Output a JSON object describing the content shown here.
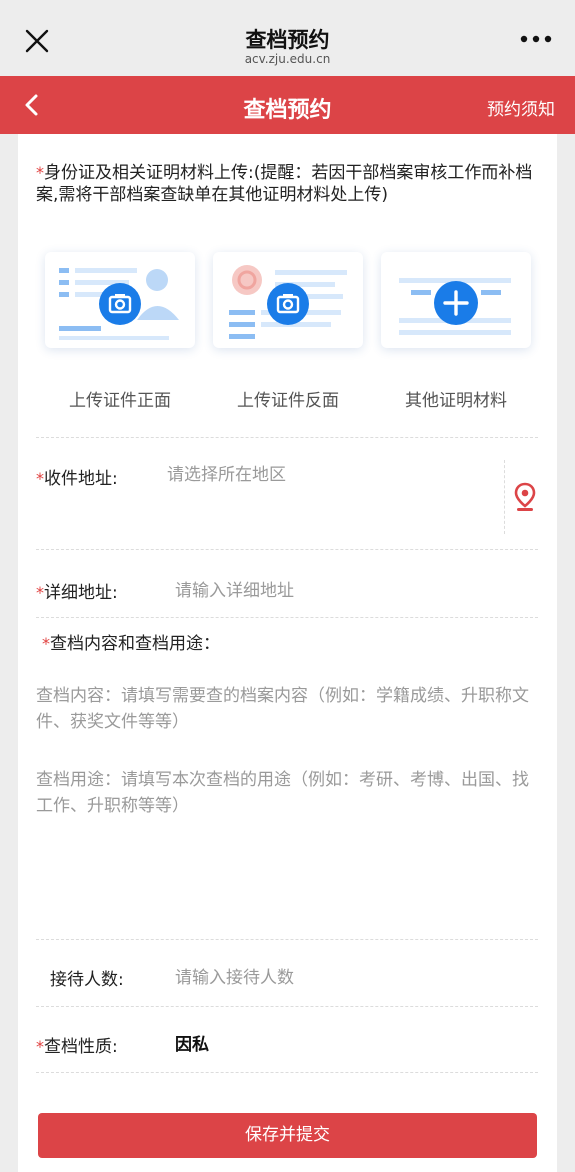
{
  "wechat": {
    "title": "查档预约",
    "domain": "acv.zju.edu.cn"
  },
  "header": {
    "title": "查档预约",
    "notice_link": "预约须知"
  },
  "upload": {
    "required_mark": "*",
    "note": "身份证及相关证明材料上传:(提醒：若因干部档案审核工作而补档案,需将干部档案查缺单在其他证明材料处上传)",
    "items": [
      {
        "label": "上传证件正面",
        "icon": "camera-icon"
      },
      {
        "label": "上传证件反面",
        "icon": "camera-icon"
      },
      {
        "label": "其他证明材料",
        "icon": "plus-icon"
      }
    ]
  },
  "form": {
    "region": {
      "required_mark": "*",
      "label": "收件地址:",
      "placeholder": "请选择所在地区",
      "icon": "location-pin-icon"
    },
    "address": {
      "required_mark": "*",
      "label": "详细地址:",
      "placeholder": "请输入详细地址"
    },
    "content_heading": {
      "required_mark": "*",
      "label": "查档内容和查档用途："
    },
    "content_placeholder": "查档内容：请填写需要查的档案内容（例如：学籍成绩、升职称文件、获奖文件等等）",
    "purpose_placeholder": "查档用途：请填写本次查档的用途（例如：考研、考博、出国、找工作、升职称等等）",
    "visitors": {
      "label": "接待人数:",
      "placeholder": "请输入接待人数"
    },
    "nature": {
      "required_mark": "*",
      "label": "查档性质:",
      "value": "因私"
    }
  },
  "submit": {
    "label": "保存并提交"
  },
  "colors": {
    "accent": "#dc4447",
    "upload_blue": "#1a7ce8"
  }
}
